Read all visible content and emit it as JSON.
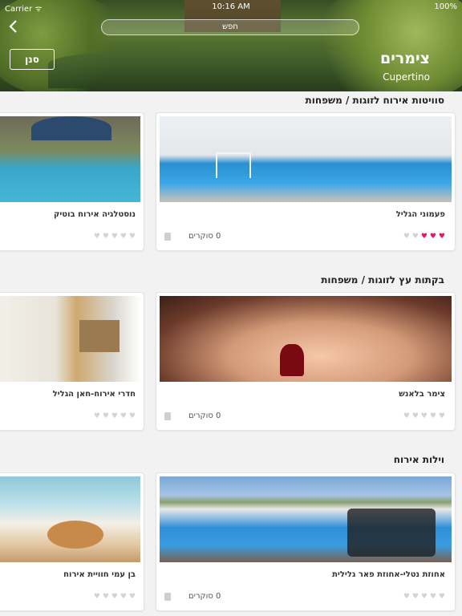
{
  "status": {
    "carrier": "Carrier ᯤ",
    "time": "10:16 AM",
    "battery": "100%"
  },
  "header": {
    "back_icon": "chevron-left-icon",
    "search_placeholder": "חפש",
    "filter_label": "סנן",
    "title": "צימרים",
    "subtitle": "Cupertino"
  },
  "sections": [
    {
      "title": "סוויטות אירוח לזוגות / משפחות",
      "cards": [
        {
          "name": "פעמוני הגליל",
          "reviews": "0 סוקרים",
          "rating": 3
        },
        {
          "name": "נוסטלגיה אירוח בוטיק",
          "reviews": "",
          "rating": 0
        }
      ]
    },
    {
      "title": "בקתות עץ לזוגות / משפחות",
      "cards": [
        {
          "name": "צימר בלאנש",
          "reviews": "0 סוקרים",
          "rating": 0
        },
        {
          "name": "חדרי אירוח-חאן הגליל",
          "reviews": "",
          "rating": 0
        }
      ]
    },
    {
      "title": "וילות אירוח",
      "cards": [
        {
          "name": "אחוזת נטלי-אחוזת פאר גלילית",
          "reviews": "0 סוקרים",
          "rating": 0
        },
        {
          "name": "בן עמי חוויית אירוח",
          "reviews": "",
          "rating": 0
        }
      ]
    }
  ],
  "colors": {
    "heart_on": "#e8156b",
    "heart_off": "#d4d4d4",
    "background": "#f2f2f2"
  }
}
